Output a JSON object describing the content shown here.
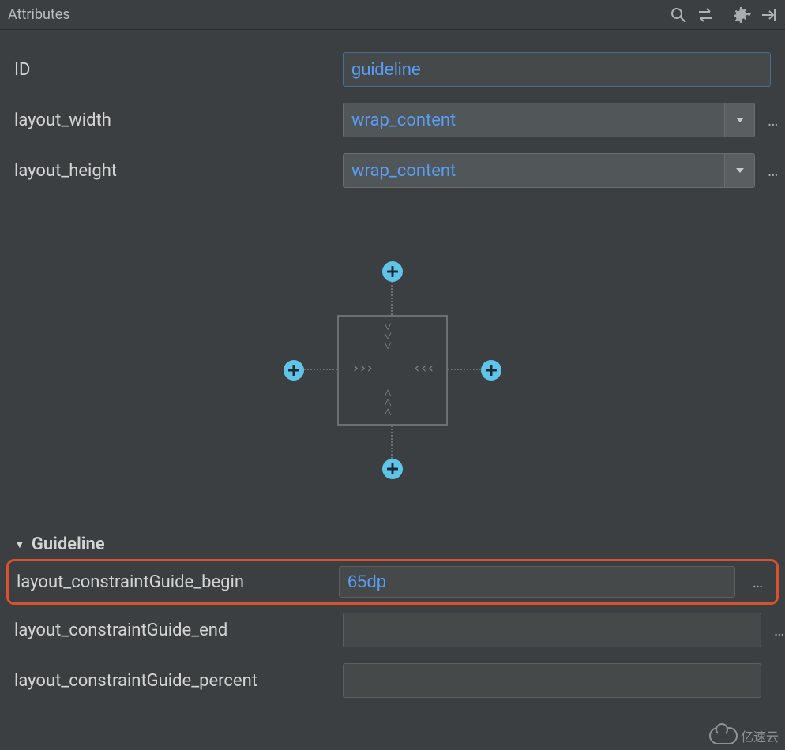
{
  "panel": {
    "title": "Attributes"
  },
  "fields": {
    "id": {
      "label": "ID",
      "value": "guideline"
    },
    "layout_width": {
      "label": "layout_width",
      "value": "wrap_content"
    },
    "layout_height": {
      "label": "layout_height",
      "value": "wrap_content"
    }
  },
  "section": {
    "title": "Guideline"
  },
  "guideline": {
    "begin": {
      "label": "layout_constraintGuide_begin",
      "value": "65dp"
    },
    "end": {
      "label": "layout_constraintGuide_end",
      "value": ""
    },
    "percent": {
      "label": "layout_constraintGuide_percent",
      "value": ""
    }
  },
  "watermark": "亿速云"
}
